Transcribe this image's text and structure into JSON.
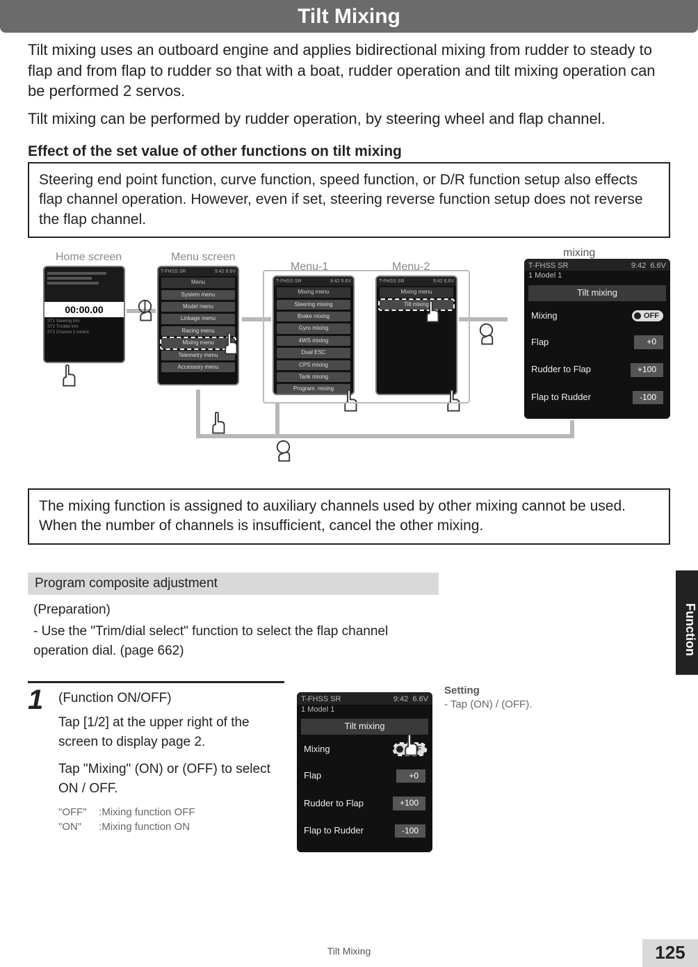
{
  "header": {
    "title": "Tilt Mixing"
  },
  "intro": {
    "p1": "Tilt mixing uses an outboard engine and applies bidirectional mixing from rudder to steady to flap and from flap to rudder so that with a boat, rudder operation and tilt mixing operation can be performed 2 servos.",
    "p2": "Tilt mixing can be performed by rudder operation, by steering wheel and flap channel."
  },
  "effect": {
    "heading": "Effect of the set value of other functions on tilt mixing",
    "body": "Steering end point function, curve function, speed function, or D/R function setup also effects flap channel operation. However, even if set, steering reverse function setup does not reverse the flap channel."
  },
  "nav": {
    "labels": {
      "home": "Home screen",
      "menu": "Menu screen",
      "menu1": "Menu-1",
      "menu2": "Menu-2",
      "mixing": "mixing"
    },
    "mini_header_left": "T-FHSS SR",
    "mini_header_time": "9:42",
    "mini_header_batt": "6.6V",
    "model_line": "Model 1",
    "home_time": "00:00.00",
    "menu_title": "Menu",
    "menu_items": [
      "System menu",
      "Model menu",
      "Linkage menu",
      "Racing menu",
      "Mixing menu",
      "Telemetry menu",
      "Accessory menu"
    ],
    "menu1_title": "Mixing menu",
    "menu1_items": [
      "Steering mixing",
      "Brake mixing",
      "Gyro mixing",
      "4WS mixing",
      "Dual ESC",
      "CPS mixing",
      "Tank mixing",
      "Program. mixing"
    ],
    "menu2_title": "Mixing menu",
    "menu2_items": [
      "Tilt mixing"
    ]
  },
  "mixing_panel": {
    "head_left": "T-FHSS SR",
    "head_time": "9:42",
    "head_batt": "6.6V",
    "model": "1    Model 1",
    "title": "Tilt mixing",
    "rows": [
      {
        "label": "Mixing",
        "value": "OFF"
      },
      {
        "label": "Flap",
        "value": "+0"
      },
      {
        "label": "Rudder to Flap",
        "value": "+100"
      },
      {
        "label": "Flap to Rudder",
        "value": "-100"
      }
    ]
  },
  "note": "The mixing function is assigned to auxiliary channels used by other mixing cannot be used. When the number of channels is insufficient, cancel the other mixing.",
  "program": {
    "bar": "Program composite adjustment",
    "prep_label": "(Preparation)",
    "prep_item": "- Use the \"Trim/dial select\" function to select the flap channel operation dial. (page 662)"
  },
  "step1": {
    "num": "1",
    "heading": "(Function ON/OFF)",
    "line1": "Tap [1/2] at the upper right of the screen to display page 2.",
    "line2": "Tap \"Mixing\" (ON) or (OFF) to select ON / OFF.",
    "off_k": "\"OFF\"",
    "off_v": ":Mixing function OFF",
    "on_k": "\"ON\"",
    "on_v": ":Mixing function ON",
    "setting_label": "Setting",
    "setting_body": "- Tap (ON) / (OFF)."
  },
  "side_tab": "Function",
  "footer_title": "Tilt Mixing",
  "page_number": "125"
}
